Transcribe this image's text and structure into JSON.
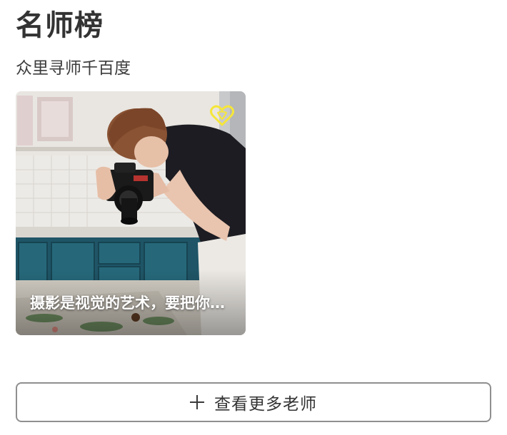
{
  "section": {
    "title": "名师榜",
    "subtitle": "众里寻师千百度"
  },
  "cards": [
    {
      "caption": "摄影是视觉的艺术，要把你看到的东西用相机记录下来",
      "favorite_icon": "heart-outline-icon",
      "favorite_color": "#f5e63a",
      "image": "photographer-with-camera-photo"
    }
  ],
  "more_button": {
    "icon": "plus-icon",
    "label": "查看更多老师"
  }
}
